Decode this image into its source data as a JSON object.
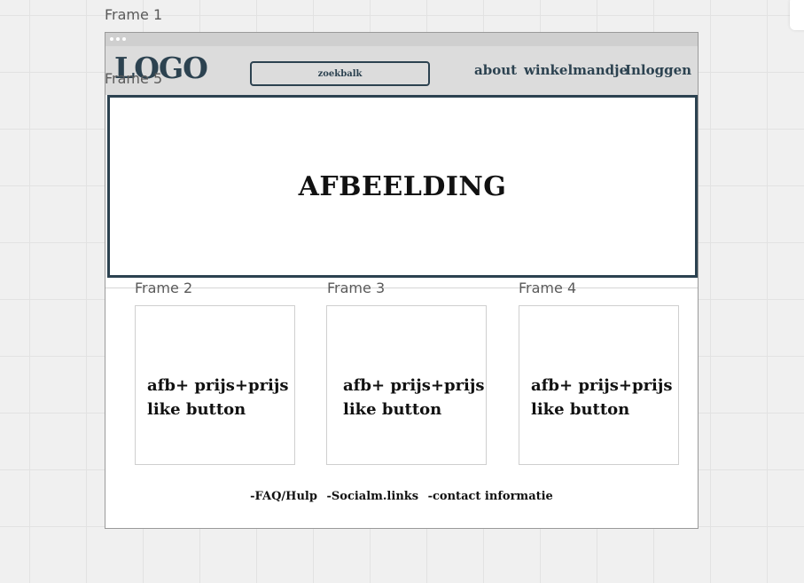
{
  "frames": {
    "frame1": "Frame 1",
    "frame5": "Frame 5",
    "frame2": "Frame 2",
    "frame3": "Frame 3",
    "frame4": "Frame 4"
  },
  "header": {
    "logo": "LOGO",
    "search_label": "zoekbalk",
    "nav": [
      "about",
      "winkelmandje",
      "Inloggen"
    ]
  },
  "hero": {
    "text": "AFBEELDING"
  },
  "cards": [
    {
      "line1": "afb+ prijs+prijs",
      "line2": "like button"
    },
    {
      "line1": "afb+ prijs+prijs",
      "line2": "like button"
    },
    {
      "line1": "afb+ prijs+prijs",
      "line2": "like button"
    }
  ],
  "footer": {
    "links": [
      "-FAQ/Hulp",
      "-Socialm.links",
      "-contact informatie"
    ]
  },
  "colors": {
    "accent": "#2c4250",
    "canvas": "#f0f0f0",
    "header_bg": "#dcdcdc"
  }
}
